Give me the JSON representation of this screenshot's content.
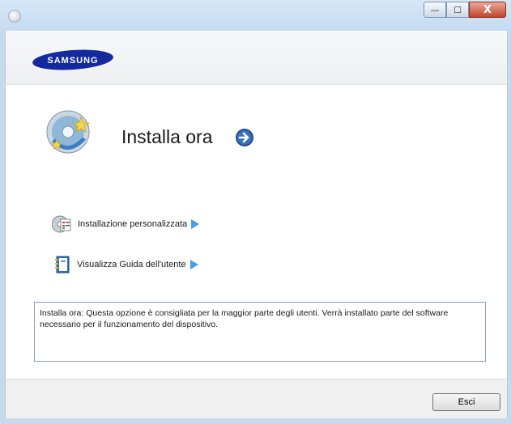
{
  "window": {
    "caption_buttons": {
      "minimize": "—",
      "maximize": "☐",
      "close": "X"
    }
  },
  "header": {
    "logo_text": "SAMSUNG"
  },
  "main": {
    "install_title": "Installa ora",
    "options": [
      {
        "label": "Installazione personalizzata",
        "icon": "custom-install-cd-icon"
      },
      {
        "label": "Visualizza Guida dell'utente",
        "icon": "user-guide-book-icon"
      }
    ],
    "description": "Installa ora: Questa opzione è consigliata per la maggior parte degli utenti. Verrà installato parte del software necessario per il funzionamento del dispositivo."
  },
  "footer": {
    "exit_label": "Esci"
  },
  "colors": {
    "brand_blue": "#1428a0",
    "arrow_blue": "#3d8fdc"
  }
}
